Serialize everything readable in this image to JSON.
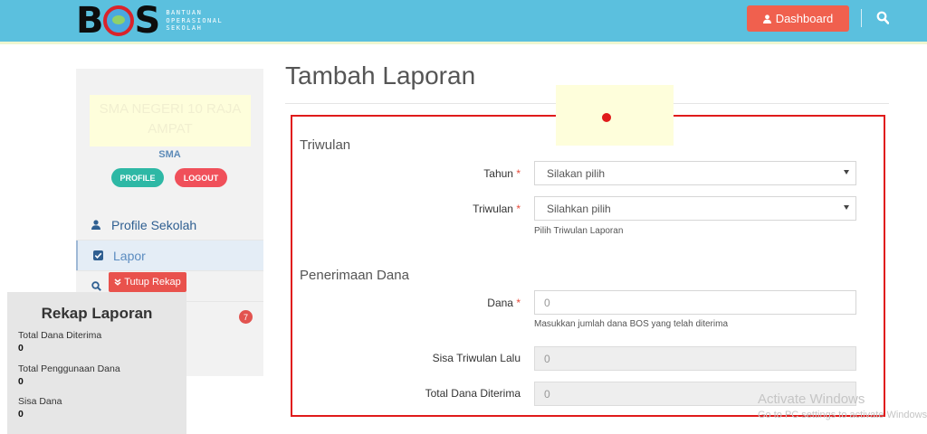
{
  "header": {
    "logo_text": "BOS",
    "logo_subtitle": [
      "BANTUAN",
      "OPERASIONAL",
      "SEKOLAH"
    ],
    "dashboard_label": "Dashboard"
  },
  "sidebar": {
    "school_name": "SMA NEGERI 10 RAJA AMPAT",
    "school_type": "SMA",
    "profile_label": "PROFILE",
    "logout_label": "LOGOUT",
    "nav": [
      {
        "label": "Profile Sekolah",
        "icon": "user-icon"
      },
      {
        "label": "Lapor",
        "icon": "checkbox-icon",
        "active": true
      },
      {
        "label": "",
        "icon": "search-icon"
      }
    ],
    "badge_count": "7",
    "tutup_rekap_label": "Tutup Rekap"
  },
  "rekap": {
    "title": "Rekap Laporan",
    "items": [
      {
        "label": "Total Dana Diterima",
        "value": "0"
      },
      {
        "label": "Total Penggunaan Dana",
        "value": "0"
      },
      {
        "label": "Sisa Dana",
        "value": "0"
      }
    ]
  },
  "main": {
    "title": "Tambah Laporan",
    "sections": {
      "triwulan": "Triwulan",
      "penerimaan": "Penerimaan Dana"
    },
    "fields": {
      "tahun": {
        "label": "Tahun",
        "value": "Silakan pilih"
      },
      "triwulan": {
        "label": "Triwulan",
        "value": "Silahkan pilih",
        "help": "Pilih Triwulan Laporan"
      },
      "dana": {
        "label": "Dana",
        "placeholder": "0",
        "help": "Masukkan jumlah dana BOS yang telah diterima"
      },
      "sisa": {
        "label": "Sisa Triwulan Lalu",
        "value": "0"
      },
      "total": {
        "label": "Total Dana Diterima",
        "value": "0"
      }
    },
    "required_mark": "*"
  },
  "watermark": {
    "line1": "Activate Windows",
    "line2": "Go to PC settings to activate Windows."
  },
  "colors": {
    "topbar": "#5bc0de",
    "dashboard_button": "#f0604e",
    "frame_highlight": "#e01b1b",
    "profile_button": "#2eb8a5",
    "logout_button": "#f0505a"
  }
}
